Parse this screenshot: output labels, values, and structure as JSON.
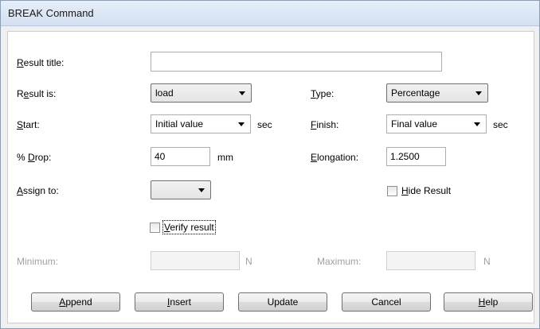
{
  "window": {
    "title": "BREAK Command"
  },
  "form": {
    "result_title": {
      "label_key": "R",
      "label_rest": "esult title:",
      "value": ""
    },
    "result_is": {
      "label_pre": "R",
      "label_key": "e",
      "label_rest": "sult is:",
      "value": "load"
    },
    "type": {
      "label_key": "T",
      "label_rest": "ype:",
      "value": "Percentage"
    },
    "start": {
      "label_key": "S",
      "label_rest": "tart:",
      "value": "Initial value",
      "unit": "sec"
    },
    "finish": {
      "label_key": "F",
      "label_rest": "inish:",
      "value": "Final value",
      "unit": "sec"
    },
    "drop": {
      "label_pre": "% ",
      "label_key": "D",
      "label_rest": "rop:",
      "value": "40",
      "unit": "mm"
    },
    "elongation": {
      "label_key": "E",
      "label_rest": "longation:",
      "value": "1.2500"
    },
    "assign_to": {
      "label_key": "A",
      "label_rest": "ssign to:",
      "value": ""
    },
    "hide_result": {
      "label_key": "H",
      "label_rest": "ide Result",
      "checked": false
    },
    "verify_result": {
      "label_key": "V",
      "label_rest": "erify result",
      "checked": false
    },
    "minimum": {
      "label": "Minimum:",
      "value": "",
      "unit": "N"
    },
    "maximum": {
      "label": "Maximum:",
      "value": "",
      "unit": "N"
    }
  },
  "buttons": {
    "append": {
      "key": "A",
      "rest": "ppend"
    },
    "insert": {
      "key": "I",
      "rest": "nsert"
    },
    "update": {
      "label": "Update"
    },
    "cancel": {
      "label": "Cancel"
    },
    "help": {
      "key": "H",
      "rest": "elp"
    }
  }
}
